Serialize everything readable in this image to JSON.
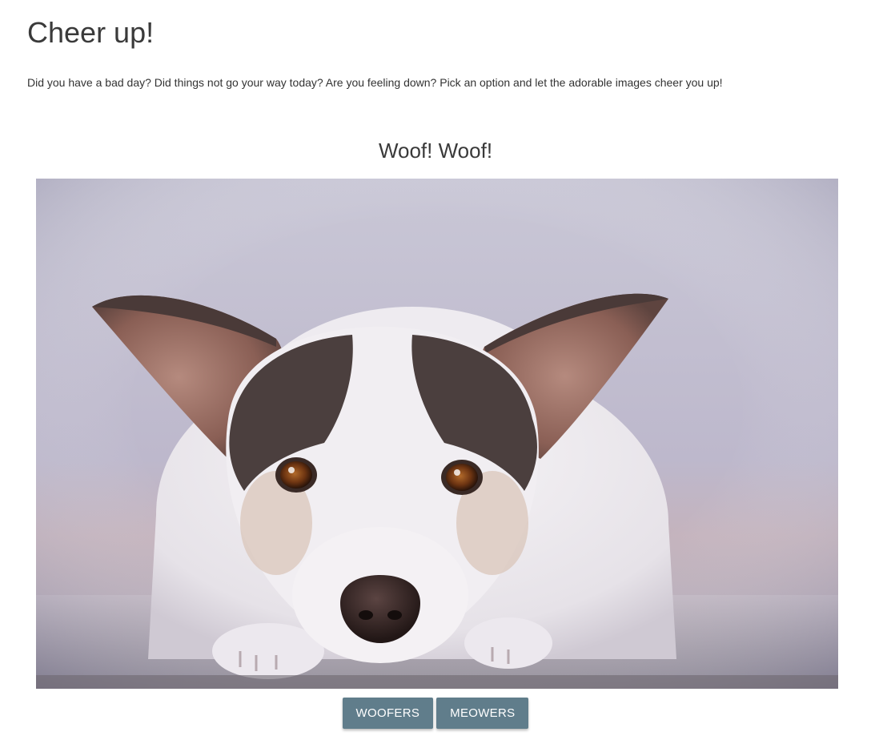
{
  "header": {
    "title": "Cheer up!",
    "intro": "Did you have a bad day? Did things not go your way today? Are you feeling down? Pick an option and let the adorable images cheer you up!"
  },
  "gallery": {
    "title": "Woof! Woof!",
    "image_subject": "white-and-brown-jack-russell-terrier-lying-down",
    "buttons": {
      "woofers_label": "WOOFERS",
      "meowers_label": "MEOWERS"
    }
  },
  "colors": {
    "button_bg": "#607d8b",
    "button_text": "#ffffff",
    "heading": "#3a3a3a"
  }
}
